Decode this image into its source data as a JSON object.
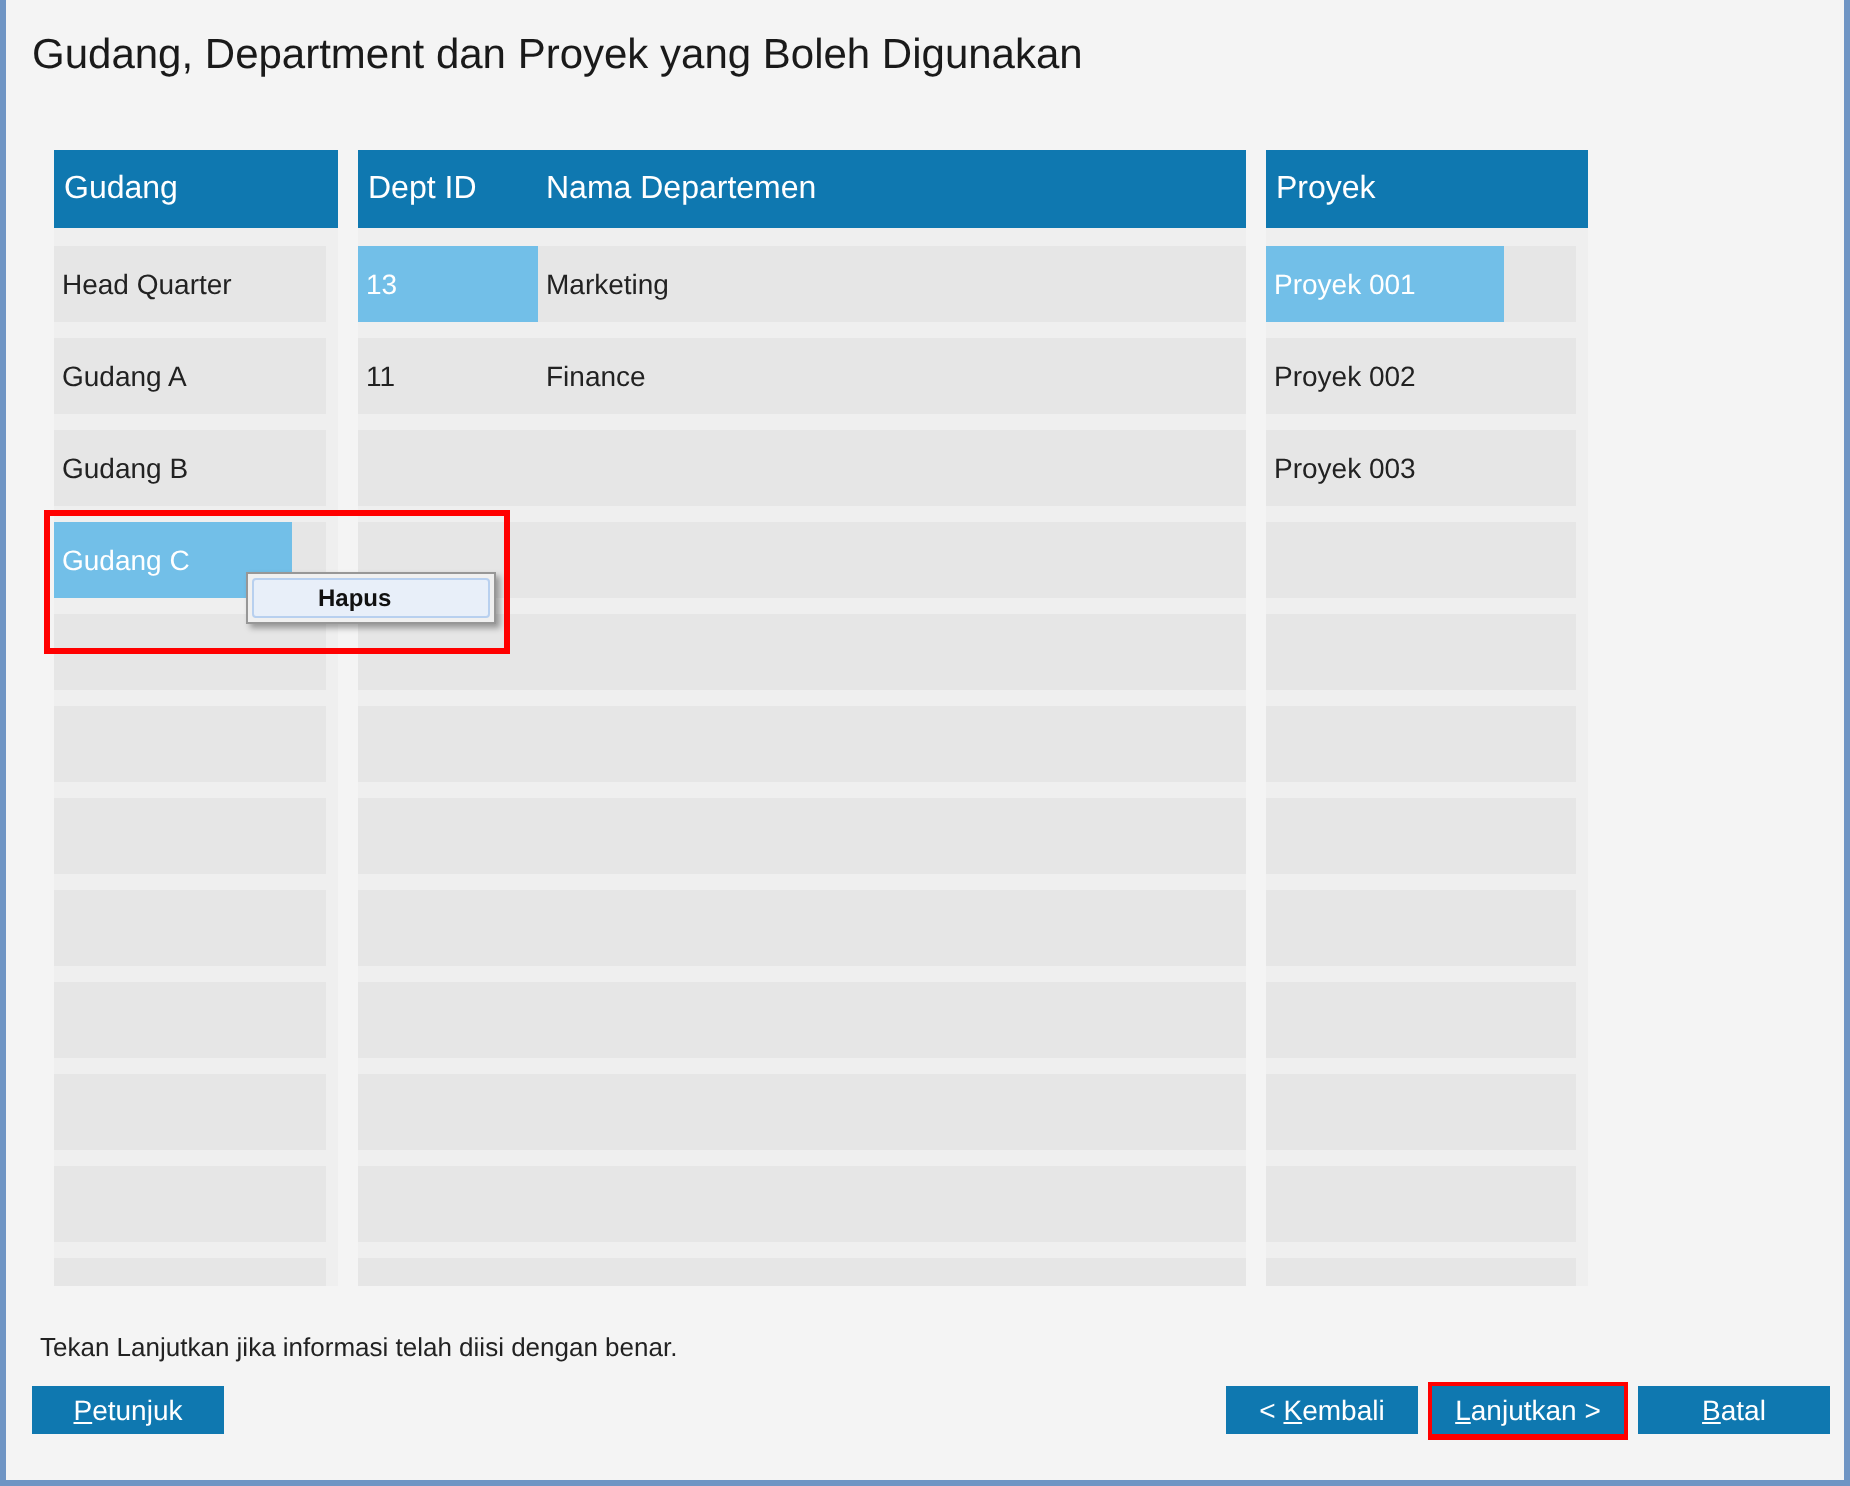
{
  "title": "Gudang, Department dan Proyek yang Boleh Digunakan",
  "gudang": {
    "header": "Gudang",
    "rows": [
      {
        "name": "Head Quarter",
        "selected": false
      },
      {
        "name": "Gudang A",
        "selected": false
      },
      {
        "name": "Gudang B",
        "selected": false
      },
      {
        "name": "Gudang C",
        "selected": true
      }
    ]
  },
  "departments": {
    "columns": [
      "Dept ID",
      "Nama Departemen"
    ],
    "rows": [
      {
        "id": "13",
        "name": "Marketing",
        "selected": true
      },
      {
        "id": "11",
        "name": "Finance",
        "selected": false
      }
    ]
  },
  "proyek": {
    "header": "Proyek",
    "rows": [
      {
        "name": "Proyek 001",
        "selected": true
      },
      {
        "name": "Proyek 002",
        "selected": false
      },
      {
        "name": "Proyek 003",
        "selected": false
      }
    ]
  },
  "context_menu": {
    "items": [
      "Hapus"
    ],
    "highlighted": true
  },
  "hint": "Tekan Lanjutkan jika informasi telah diisi dengan benar.",
  "help_button": {
    "key": "P",
    "after": "etunjuk",
    "highlighted": false
  },
  "buttons": [
    {
      "before": "< ",
      "key": "K",
      "after": "embali",
      "highlighted": false
    },
    {
      "key": "L",
      "after": "anjutkan >",
      "highlighted": true
    },
    {
      "key": "B",
      "after": "atal",
      "highlighted": false
    }
  ]
}
